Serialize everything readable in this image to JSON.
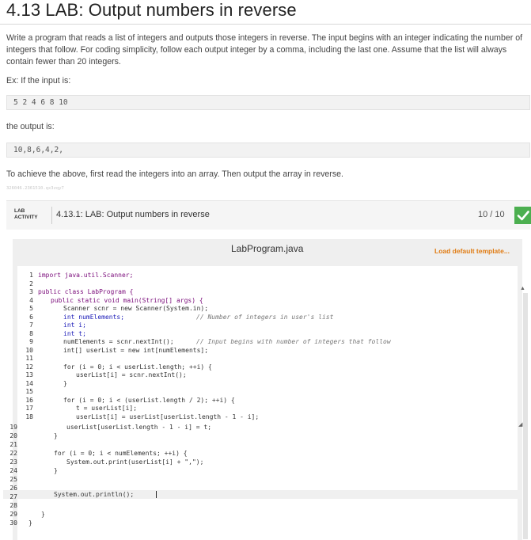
{
  "page": {
    "title": "4.13 LAB: Output numbers in reverse",
    "description": "Write a program that reads a list of integers and outputs those integers in reverse. The input begins with an integer indicating the number of integers that follow. For coding simplicity, follow each output integer by a comma, including the last one. Assume that the list will always contain fewer than 20 integers.",
    "example_label": "Ex: If the input is:",
    "example_input": "5 2 4 6 8 10",
    "output_label": "the output is:",
    "example_output": "10,8,6,4,2,",
    "hint": "To achieve the above, first read the integers into an array. Then output the array in reverse.",
    "tracking_id": "326046.2361510.qx3zqy7"
  },
  "lab": {
    "badge_line1": "LAB",
    "badge_line2": "ACTIVITY",
    "title": "4.13.1: LAB: Output numbers in reverse",
    "score": "10 / 10",
    "check_icon": "checkmark-icon",
    "accent_color": "#4caf50"
  },
  "editor": {
    "filename": "LabProgram.java",
    "load_template_label": "Load default template...",
    "line_numbers": [
      "1",
      "2",
      "3",
      "4",
      "5",
      "6",
      "7",
      "8",
      "9",
      "10",
      "11",
      "12",
      "13",
      "14",
      "15",
      "16",
      "17",
      "18",
      "19",
      "20",
      "21",
      "22",
      "23",
      "24",
      "25",
      "26",
      "27",
      "28",
      "29",
      "30"
    ],
    "code": {
      "l1": "import java.util.Scanner;",
      "l3": "public class LabProgram {",
      "l4": "public static void main(String[] args) {",
      "l5": "Scanner scnr = new Scanner(System.in);",
      "l6_code": "int numElements;",
      "l6_comment": "// Number of integers in user's list",
      "l7": "int i;",
      "l8": "int t;",
      "l9_code": "numElements = scnr.nextInt();",
      "l9_comment": "// Input begins with number of integers that follow",
      "l10": "int[] userList = new int[numElements];",
      "l12": "for (i = 0; i < userList.length; ++i) {",
      "l13": "userList[i] = scnr.nextInt();",
      "l14": "}",
      "l16": "for (i = 0; i < (userList.length / 2); ++i) {",
      "l17": "t = userList[i];",
      "l18": "userList[i] = userList[userList.length - 1 - i];",
      "l19": "userList[userList.length - 1 - i] = t;",
      "l20": "}",
      "l22": "for (i = 0; i < numElements; ++i) {",
      "l23": "System.out.print(userList[i] + \",\");",
      "l24": "}",
      "l26": "System.out.println();",
      "l28": "}",
      "l29": "}"
    }
  }
}
